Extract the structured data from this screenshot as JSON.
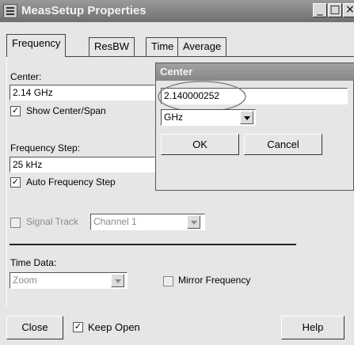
{
  "window": {
    "title": "MeasSetup Properties",
    "controls": {
      "minimize": "_",
      "maximize": "□",
      "close": "×"
    }
  },
  "tabs": [
    {
      "label": "Frequency",
      "active": true
    },
    {
      "label": "ResBW",
      "active": false
    },
    {
      "label": "Time",
      "active": false
    },
    {
      "label": "Average",
      "active": false
    }
  ],
  "frequency": {
    "center_label": "Center:",
    "center_value": "2.14 GHz",
    "show_center_span_label": "Show Center/Span",
    "show_center_span_checked": true,
    "step_label": "Frequency Step:",
    "step_value": "25 kHz",
    "auto_step_label": "Auto Frequency Step",
    "auto_step_checked": true,
    "signal_track_label": "Signal Track",
    "signal_track_checked": false,
    "signal_track_value": "Channel 1",
    "time_data_label": "Time Data:",
    "time_data_value": "Zoom",
    "mirror_label": "Mirror Frequency",
    "mirror_checked": false
  },
  "footer": {
    "close_label": "Close",
    "keep_open_label": "Keep Open",
    "keep_open_checked": true,
    "help_label": "Help"
  },
  "center_dialog": {
    "title": "Center",
    "value": "2.140000252",
    "unit": "GHz",
    "ok_label": "OK",
    "cancel_label": "Cancel"
  },
  "check_glyph": "✓",
  "colors": {
    "title_bar": "#7f7f7f",
    "face": "#e6e6e6",
    "annotation": "#777777"
  }
}
